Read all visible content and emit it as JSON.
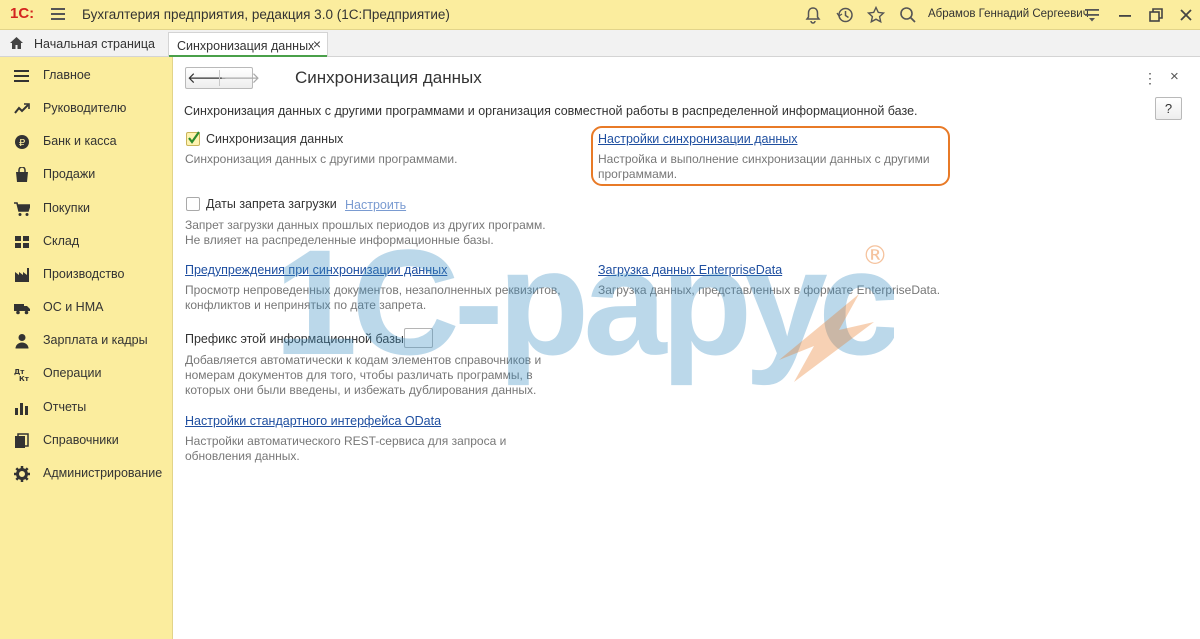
{
  "titlebar": {
    "logo": "1С:",
    "title": "Бухгалтерия предприятия, редакция 3.0  (1С:Предприятие)",
    "user": "Абрамов Геннадий Сергеевич"
  },
  "tabs": {
    "home": "Начальная страница",
    "active": "Синхронизация данных",
    "close": "×"
  },
  "sidebar": {
    "items": [
      {
        "label": "Главное",
        "icon": "menu-lines-icon"
      },
      {
        "label": "Руководителю",
        "icon": "trend-icon"
      },
      {
        "label": "Банк и касса",
        "icon": "ruble-coin-icon"
      },
      {
        "label": "Продажи",
        "icon": "shopping-bag-icon"
      },
      {
        "label": "Покупки",
        "icon": "cart-icon"
      },
      {
        "label": "Склад",
        "icon": "warehouse-icon"
      },
      {
        "label": "Производство",
        "icon": "factory-icon"
      },
      {
        "label": "ОС и НМА",
        "icon": "truck-icon"
      },
      {
        "label": "Зарплата и кадры",
        "icon": "person-icon"
      },
      {
        "label": "Операции",
        "icon": "dt-kt-icon"
      },
      {
        "label": "Отчеты",
        "icon": "bar-chart-icon"
      },
      {
        "label": "Справочники",
        "icon": "books-icon"
      },
      {
        "label": "Администрирование",
        "icon": "gear-icon"
      }
    ]
  },
  "form": {
    "title": "Синхронизация данных",
    "help": "?",
    "description": "Синхронизация данных с другими программами и организация совместной работы в распределенной информационной базе.",
    "sync": {
      "label": "Синхронизация данных",
      "checked": true,
      "hint": "Синхронизация данных с другими программами."
    },
    "sync_settings": {
      "link": "Настройки синхронизации данных",
      "hint_line1": "Настройка и выполнение синхронизации данных с другими",
      "hint_line2": "программами."
    },
    "ban_dates": {
      "label": "Даты запрета загрузки",
      "checked": false,
      "configure": "Настроить",
      "hint_line1": "Запрет загрузки данных прошлых периодов из других программ.",
      "hint_line2": "Не влияет на распределенные информационные базы."
    },
    "warnings": {
      "link": "Предупреждения при синхронизации данных",
      "hint_line1": "Просмотр непроведенных документов, незаполненных реквизитов,",
      "hint_line2": "конфликтов и непринятых по дате запрета."
    },
    "enterprise_data": {
      "link": "Загрузка данных EnterpriseData",
      "hint": "Загрузка данных, представленных в формате EnterpriseData."
    },
    "prefix": {
      "label": "Префикс этой информационной базы:",
      "value": "",
      "hint_line1": "Добавляется автоматически к кодам элементов справочников и",
      "hint_line2": "номерам документов для того, чтобы различать программы, в",
      "hint_line3": "которых они были введены, и избежать дублирования данных."
    },
    "odata": {
      "link": "Настройки стандартного интерфейса OData",
      "hint_line1": "Настройки автоматического REST-сервиса для запроса и",
      "hint_line2": "обновления данных."
    }
  },
  "watermark": {
    "text": "1С-рарус",
    "mark": "®"
  },
  "colors": {
    "accent_bg": "#fbed9e",
    "link": "#1f4fa0",
    "highlight": "#e87a27",
    "watermark": "#3b8fc4"
  }
}
